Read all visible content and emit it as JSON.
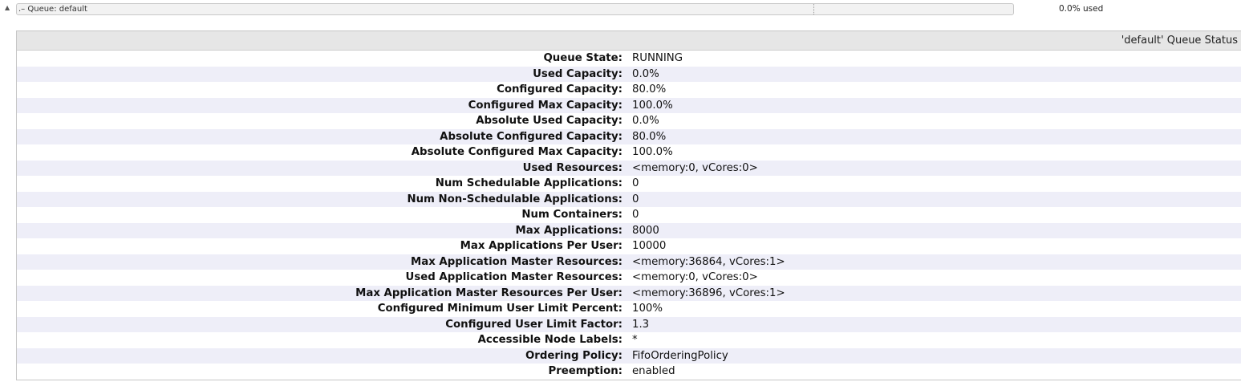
{
  "queue": {
    "toggle_glyph": "▲",
    "bar_label": ".– Queue: default",
    "configured_capacity_fraction": 0.8,
    "used_capacity_fraction": 0.0,
    "used_text": "0.0% used",
    "colors": {
      "bar_background": "#f2f2f2",
      "used_fill": "#6dbb5a",
      "border": "#c7c7c7"
    }
  },
  "status_panel": {
    "title": "'default' Queue Status",
    "colors": {
      "header_bg": "#e6e6e6",
      "row_even": "#eeeef8",
      "row_odd": "#ffffff"
    },
    "rows": [
      {
        "label": "Queue State:",
        "value": "RUNNING"
      },
      {
        "label": "Used Capacity:",
        "value": "0.0%"
      },
      {
        "label": "Configured Capacity:",
        "value": "80.0%"
      },
      {
        "label": "Configured Max Capacity:",
        "value": "100.0%"
      },
      {
        "label": "Absolute Used Capacity:",
        "value": "0.0%"
      },
      {
        "label": "Absolute Configured Capacity:",
        "value": "80.0%"
      },
      {
        "label": "Absolute Configured Max Capacity:",
        "value": "100.0%"
      },
      {
        "label": "Used Resources:",
        "value": "<memory:0, vCores:0>"
      },
      {
        "label": "Num Schedulable Applications:",
        "value": "0"
      },
      {
        "label": "Num Non-Schedulable Applications:",
        "value": "0"
      },
      {
        "label": "Num Containers:",
        "value": "0"
      },
      {
        "label": "Max Applications:",
        "value": "8000"
      },
      {
        "label": "Max Applications Per User:",
        "value": "10000"
      },
      {
        "label": "Max Application Master Resources:",
        "value": "<memory:36864, vCores:1>"
      },
      {
        "label": "Used Application Master Resources:",
        "value": "<memory:0, vCores:0>"
      },
      {
        "label": "Max Application Master Resources Per User:",
        "value": "<memory:36896, vCores:1>"
      },
      {
        "label": "Configured Minimum User Limit Percent:",
        "value": "100%"
      },
      {
        "label": "Configured User Limit Factor:",
        "value": "1.3"
      },
      {
        "label": "Accessible Node Labels:",
        "value": "*"
      },
      {
        "label": "Ordering Policy:",
        "value": "FifoOrderingPolicy"
      },
      {
        "label": "Preemption:",
        "value": "enabled"
      }
    ]
  }
}
